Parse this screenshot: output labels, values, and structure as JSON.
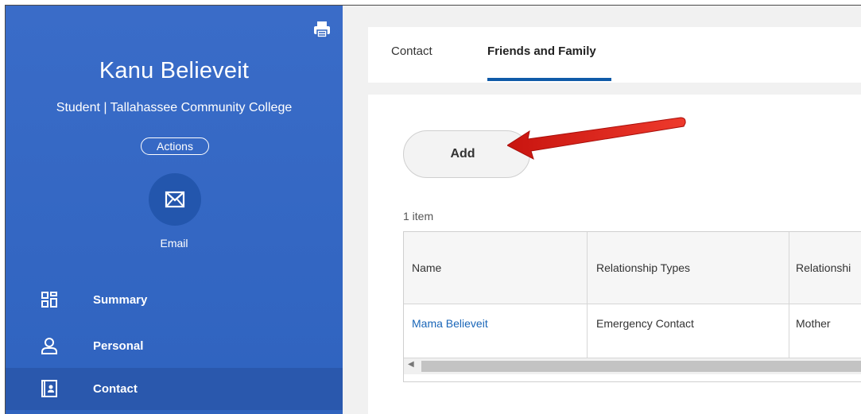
{
  "profile": {
    "name": "Kanu Believeit",
    "subtitle": "Student | Tallahassee Community College",
    "actions_label": "Actions",
    "email_label": "Email"
  },
  "nav": {
    "items": [
      {
        "label": "Summary",
        "icon": "grid-icon"
      },
      {
        "label": "Personal",
        "icon": "person-icon"
      },
      {
        "label": "Contact",
        "icon": "contact-book-icon",
        "active": true
      }
    ]
  },
  "tabs": [
    {
      "label": "Contact"
    },
    {
      "label": "Friends and Family",
      "active": true
    }
  ],
  "content": {
    "add_label": "Add",
    "item_count": "1 item",
    "table": {
      "headers": [
        "Name",
        "Relationship Types",
        "Relationshi"
      ],
      "rows": [
        [
          "Mama Believeit",
          "Emergency Contact",
          "Mother"
        ]
      ]
    }
  },
  "colors": {
    "sidebar": "#3a6cc8",
    "sidebar_active": "#2a58ad",
    "tab_underline": "#0f5aa8",
    "link": "#1a66b8",
    "annotation_arrow": "#e0201a"
  }
}
